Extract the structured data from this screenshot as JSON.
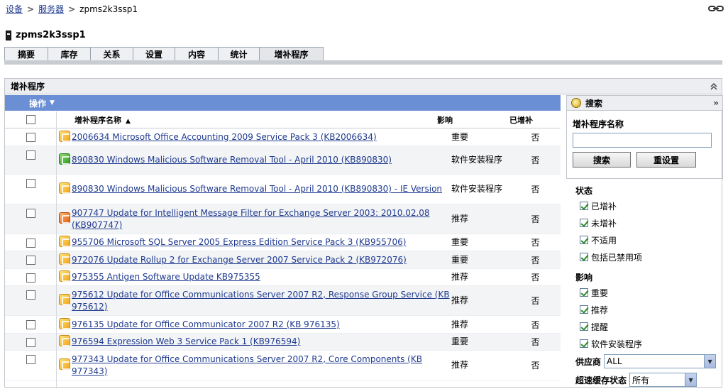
{
  "breadcrumb": {
    "root": "设备",
    "servers": "服务器",
    "current": "zpms2k3ssp1"
  },
  "device": {
    "name": "zpms2k3ssp1"
  },
  "tabs": [
    {
      "label": "摘要"
    },
    {
      "label": "库存"
    },
    {
      "label": "关系"
    },
    {
      "label": "设置"
    },
    {
      "label": "内容"
    },
    {
      "label": "统计"
    },
    {
      "label": "增补程序",
      "active": true
    }
  ],
  "panel": {
    "title": "增补程序"
  },
  "actions": {
    "label": "操作"
  },
  "table": {
    "headers": {
      "name": "增补程序名称",
      "impact": "影响",
      "patched": "已增补"
    },
    "rows": [
      {
        "icon": "yellow",
        "name": "2006634 Microsoft Office Accounting 2009 Service Pack 3 (KB2006634)",
        "impact": "重要",
        "patched": "否"
      },
      {
        "icon": "green",
        "name": "890830 Windows Malicious Software Removal Tool - April 2010 (KB890830)",
        "impact": "软件安装程序",
        "patched": "否"
      },
      {
        "icon": "yellow",
        "name": "890830 Windows Malicious Software Removal Tool - April 2010 (KB890830) - IE Version",
        "impact": "软件安装程序",
        "patched": "否"
      },
      {
        "icon": "orange",
        "name": "907747 Update for Intelligent Message Filter for Exchange Server 2003: 2010.02.08 (KB907747)",
        "impact": "推荐",
        "patched": "否"
      },
      {
        "icon": "yellow",
        "name": "955706 Microsoft SQL Server 2005 Express Edition Service Pack 3 (KB955706)",
        "impact": "重要",
        "patched": "否"
      },
      {
        "icon": "yellow",
        "name": "972076 Update Rollup 2 for Exchange Server 2007 Service Pack 2 (KB972076)",
        "impact": "重要",
        "patched": "否"
      },
      {
        "icon": "yellow",
        "name": "975355 Antigen Software Update KB975355",
        "impact": "推荐",
        "patched": "否"
      },
      {
        "icon": "yellow",
        "name": "975612 Update for Office Communications Server 2007 R2, Response Group Service (KB 975612)",
        "impact": "推荐",
        "patched": "否"
      },
      {
        "icon": "yellow",
        "name": "976135 Update for Office Communicator 2007 R2 (KB 976135)",
        "impact": "推荐",
        "patched": "否"
      },
      {
        "icon": "yellow",
        "name": "976594 Expression Web 3 Service Pack 1 (KB976594)",
        "impact": "重要",
        "patched": "否"
      },
      {
        "icon": "yellow",
        "name": "977343 Update for Office Communications Server 2007 R2, Core Components (KB 977343)",
        "impact": "推荐",
        "patched": "否"
      }
    ]
  },
  "search": {
    "title": "搜索",
    "name_label": "增补程序名称",
    "name_value": "",
    "search_button": "搜索",
    "reset_button": "重设置",
    "status_title": "状态",
    "status_items": [
      {
        "label": "已增补",
        "checked": true
      },
      {
        "label": "未增补",
        "checked": true
      },
      {
        "label": "不适用",
        "checked": true
      },
      {
        "label": "包括已禁用项",
        "checked": true
      }
    ],
    "impact_title": "影响",
    "impact_items": [
      {
        "label": "重要",
        "checked": true
      },
      {
        "label": "推荐",
        "checked": true
      },
      {
        "label": "提醒",
        "checked": true
      },
      {
        "label": "软件安装程序",
        "checked": true
      }
    ],
    "vendor_label": "供应商",
    "vendor_value": "ALL",
    "cache_label": "超速缓存状态",
    "cache_value": "所有"
  },
  "colors": {
    "actions_bar": "#6b8fd4",
    "link": "#1f3a8f"
  }
}
